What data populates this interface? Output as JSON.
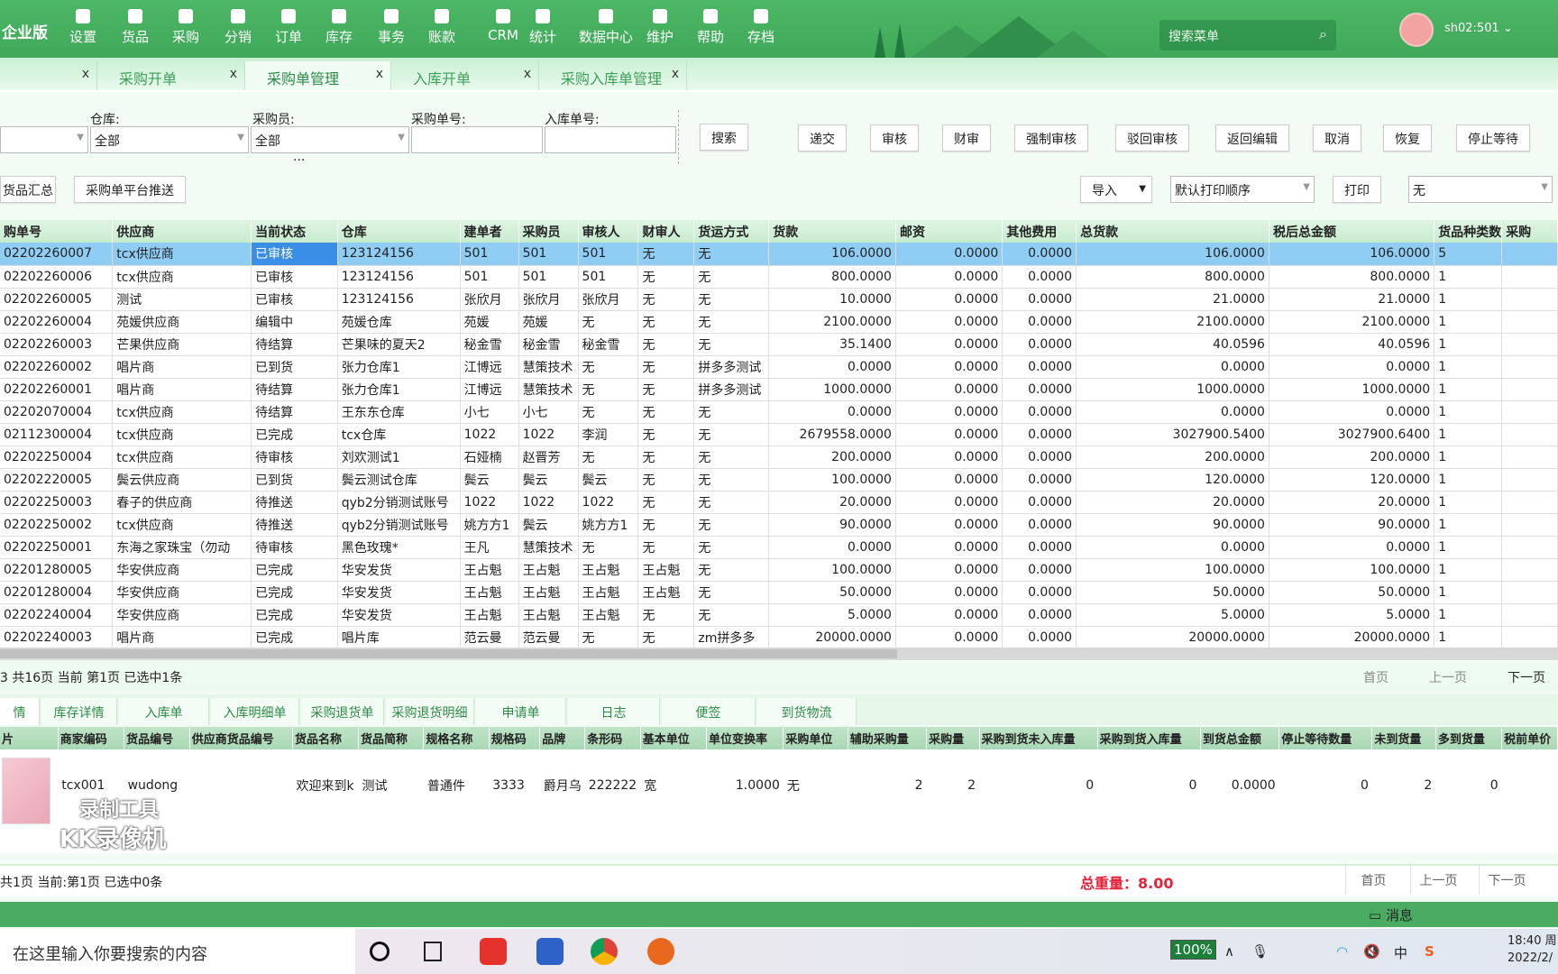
{
  "header": {
    "brand": "企业版",
    "nav": [
      "设置",
      "货品",
      "采购",
      "分销",
      "订单",
      "库存",
      "事务",
      "账款",
      "CRM",
      "统计",
      "数据中心",
      "维护",
      "帮助",
      "存档"
    ],
    "menu_search_placeholder": "搜索菜单",
    "user": "sh02:501"
  },
  "tabs": [
    {
      "label": "",
      "active": false
    },
    {
      "label": "采购开单",
      "active": false
    },
    {
      "label": "采购单管理",
      "active": true
    },
    {
      "label": "入库开单",
      "active": false
    },
    {
      "label": "采购入库单管理",
      "active": false
    }
  ],
  "tab_close": "x",
  "filters": {
    "warehouse_label": "仓库:",
    "warehouse_value": "全部",
    "buyer_label": "采购员:",
    "buyer_value": "全部",
    "po_label": "采购单号:",
    "po_value": "",
    "in_label": "入库单号:",
    "in_value": "",
    "more": "..."
  },
  "toolbar": {
    "search": "搜索",
    "actions": [
      "递交",
      "审核",
      "财审",
      "强制审核",
      "驳回审核",
      "返回编辑",
      "取消",
      "恢复",
      "停止等待"
    ],
    "summary": "货品汇总",
    "push": "采购单平台推送",
    "import": "导入",
    "print_order": "默认打印顺序",
    "print": "打印",
    "print_template": "无"
  },
  "grid": {
    "columns": [
      "购单号",
      "供应商",
      "当前状态",
      "仓库",
      "建单者",
      "采购员",
      "审核人",
      "财审人",
      "货运方式",
      "货款",
      "邮资",
      "其他费用",
      "总货款",
      "税后总金额",
      "货品种类数",
      "采购"
    ],
    "rows": [
      [
        "02202260007",
        "tcx供应商",
        "已审核",
        "123124156",
        "501",
        "501",
        "501",
        "无",
        "无",
        "106.0000",
        "0.0000",
        "0.0000",
        "106.0000",
        "106.0000",
        "5",
        ""
      ],
      [
        "02202260006",
        "tcx供应商",
        "已审核",
        "123124156",
        "501",
        "501",
        "501",
        "无",
        "无",
        "800.0000",
        "0.0000",
        "0.0000",
        "800.0000",
        "800.0000",
        "1",
        ""
      ],
      [
        "02202260005",
        "测试",
        "已审核",
        "123124156",
        "张欣月",
        "张欣月",
        "张欣月",
        "无",
        "无",
        "10.0000",
        "0.0000",
        "0.0000",
        "21.0000",
        "21.0000",
        "1",
        ""
      ],
      [
        "02202260004",
        "苑媛供应商",
        "编辑中",
        "苑媛仓库",
        "苑媛",
        "苑媛",
        "无",
        "无",
        "无",
        "2100.0000",
        "0.0000",
        "0.0000",
        "2100.0000",
        "2100.0000",
        "1",
        ""
      ],
      [
        "02202260003",
        "芒果供应商",
        "待结算",
        "芒果味的夏天2",
        "秘金雪",
        "秘金雪",
        "秘金雪",
        "无",
        "无",
        "35.1400",
        "0.0000",
        "0.0000",
        "40.0596",
        "40.0596",
        "1",
        ""
      ],
      [
        "02202260002",
        "唱片商",
        "已到货",
        "张力仓库1",
        "江博远",
        "慧策技术",
        "无",
        "无",
        "拼多多测试",
        "0.0000",
        "0.0000",
        "0.0000",
        "0.0000",
        "0.0000",
        "1",
        ""
      ],
      [
        "02202260001",
        "唱片商",
        "待结算",
        "张力仓库1",
        "江博远",
        "慧策技术",
        "无",
        "无",
        "拼多多测试",
        "1000.0000",
        "0.0000",
        "0.0000",
        "1000.0000",
        "1000.0000",
        "1",
        ""
      ],
      [
        "02202070004",
        "tcx供应商",
        "待结算",
        "王东东仓库",
        "小七",
        "小七",
        "无",
        "无",
        "无",
        "0.0000",
        "0.0000",
        "0.0000",
        "0.0000",
        "0.0000",
        "1",
        ""
      ],
      [
        "02112300004",
        "tcx供应商",
        "已完成",
        "tcx仓库",
        "1022",
        "1022",
        "李润",
        "无",
        "无",
        "2679558.0000",
        "0.0000",
        "0.0000",
        "3027900.5400",
        "3027900.6400",
        "1",
        ""
      ],
      [
        "02202250004",
        "tcx供应商",
        "待审核",
        "刘欢测试1",
        "石娅楠",
        "赵晋芳",
        "无",
        "无",
        "无",
        "200.0000",
        "0.0000",
        "0.0000",
        "200.0000",
        "200.0000",
        "1",
        ""
      ],
      [
        "02202220005",
        "鬓云供应商",
        "已到货",
        "鬓云测试仓库",
        "鬓云",
        "鬓云",
        "鬓云",
        "无",
        "无",
        "100.0000",
        "0.0000",
        "0.0000",
        "120.0000",
        "120.0000",
        "1",
        ""
      ],
      [
        "02202250003",
        "春子的供应商",
        "待推送",
        "qyb2分销测试账号",
        "1022",
        "1022",
        "1022",
        "无",
        "无",
        "20.0000",
        "0.0000",
        "0.0000",
        "20.0000",
        "20.0000",
        "1",
        ""
      ],
      [
        "02202250002",
        "tcx供应商",
        "待推送",
        "qyb2分销测试账号",
        "姚方方1",
        "鬓云",
        "姚方方1",
        "无",
        "无",
        "90.0000",
        "0.0000",
        "0.0000",
        "90.0000",
        "90.0000",
        "1",
        ""
      ],
      [
        "02202250001",
        "东海之家珠宝（勿动",
        "待审核",
        "黑色玫瑰*",
        "王凡",
        "慧策技术",
        "无",
        "无",
        "无",
        "0.0000",
        "0.0000",
        "0.0000",
        "0.0000",
        "0.0000",
        "1",
        ""
      ],
      [
        "02201280005",
        "华安供应商",
        "已完成",
        "华安发货",
        "王占魁",
        "王占魁",
        "王占魁",
        "王占魁",
        "无",
        "100.0000",
        "0.0000",
        "0.0000",
        "100.0000",
        "100.0000",
        "1",
        ""
      ],
      [
        "02201280004",
        "华安供应商",
        "已完成",
        "华安发货",
        "王占魁",
        "王占魁",
        "王占魁",
        "王占魁",
        "无",
        "50.0000",
        "0.0000",
        "0.0000",
        "50.0000",
        "50.0000",
        "1",
        ""
      ],
      [
        "02202240004",
        "华安供应商",
        "已完成",
        "华安发货",
        "王占魁",
        "王占魁",
        "王占魁",
        "无",
        "无",
        "5.0000",
        "0.0000",
        "0.0000",
        "5.0000",
        "5.0000",
        "1",
        ""
      ],
      [
        "02202240003",
        "唱片商",
        "已完成",
        "唱片库",
        "范云曼",
        "范云曼",
        "无",
        "无",
        "zm拼多多",
        "20000.0000",
        "0.0000",
        "0.0000",
        "20000.0000",
        "20000.0000",
        "1",
        ""
      ]
    ]
  },
  "pager": {
    "info": "3  共16页  当前  第1页  已选中1条",
    "first": "首页",
    "prev": "上一页",
    "next": "下一页"
  },
  "detail_tabs": [
    "情",
    "库存详情",
    "入库单",
    "入库明细单",
    "采购退货单",
    "采购退货明细",
    "申请单",
    "日志",
    "便签",
    "到货物流"
  ],
  "detail": {
    "columns": [
      "片",
      "商家编码",
      "货品编号",
      "供应商货品编号",
      "货品名称",
      "货品简称",
      "规格名称",
      "规格码",
      "品牌",
      "条形码",
      "基本单位",
      "单位变换率",
      "采购单位",
      "辅助采购量",
      "采购量",
      "采购到货未入库量",
      "采购到货入库量",
      "到货总金额",
      "停止等待数量",
      "未到货量",
      "多到货量",
      "税前单价"
    ],
    "rows": [
      [
        "",
        "tcx001",
        "wudong",
        "",
        "欢迎来到k",
        "测试",
        "普通件",
        "3333",
        "爵月乌",
        "222222",
        "宽",
        "1.0000",
        "无",
        "2",
        "2",
        "0",
        "0",
        "0.0000",
        "0",
        "2",
        "0",
        ""
      ]
    ]
  },
  "detail_status": {
    "info": "共1页 当前:第1页 已选中0条",
    "weight": "总重量：8.00",
    "first": "首页",
    "prev": "上一页",
    "next": "下一页"
  },
  "watermark": [
    "录制工具",
    "KK录像机"
  ],
  "statusbar": {
    "message": "消息"
  },
  "taskbar": {
    "search_placeholder": "在这里输入你要搜索的内容",
    "battery": "100%",
    "ime": "中",
    "time": "18:40 周",
    "date": "2022/2/"
  },
  "colors": {
    "header": "#4cb764",
    "selected_row": "#8fcdf5",
    "selected_status": "#3a8ee6",
    "weight": "#e2233a"
  }
}
